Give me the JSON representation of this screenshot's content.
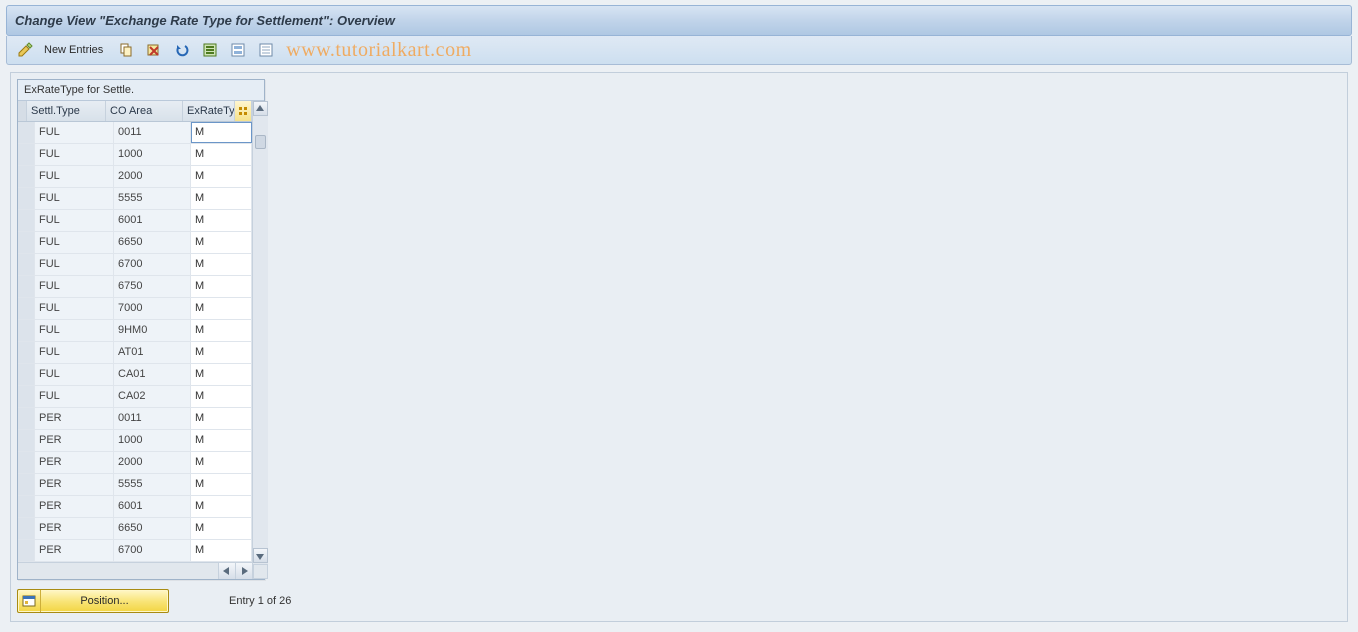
{
  "title": "Change View \"Exchange Rate Type for Settlement\": Overview",
  "toolbar": {
    "new_entries_label": "New Entries"
  },
  "watermark": "www.tutorialkart.com",
  "grid": {
    "title": "ExRateType for Settle.",
    "headers": {
      "settl_type": "Settl.Type",
      "co_area": "CO Area",
      "ex_rate_type": "ExRateType"
    },
    "rows": [
      {
        "settl": "FUL",
        "co": "0011",
        "ex": "M"
      },
      {
        "settl": "FUL",
        "co": "1000",
        "ex": "M"
      },
      {
        "settl": "FUL",
        "co": "2000",
        "ex": "M"
      },
      {
        "settl": "FUL",
        "co": "5555",
        "ex": "M"
      },
      {
        "settl": "FUL",
        "co": "6001",
        "ex": "M"
      },
      {
        "settl": "FUL",
        "co": "6650",
        "ex": "M"
      },
      {
        "settl": "FUL",
        "co": "6700",
        "ex": "M"
      },
      {
        "settl": "FUL",
        "co": "6750",
        "ex": "M"
      },
      {
        "settl": "FUL",
        "co": "7000",
        "ex": "M"
      },
      {
        "settl": "FUL",
        "co": "9HM0",
        "ex": "M"
      },
      {
        "settl": "FUL",
        "co": "AT01",
        "ex": "M"
      },
      {
        "settl": "FUL",
        "co": "CA01",
        "ex": "M"
      },
      {
        "settl": "FUL",
        "co": "CA02",
        "ex": "M"
      },
      {
        "settl": "PER",
        "co": "0011",
        "ex": "M"
      },
      {
        "settl": "PER",
        "co": "1000",
        "ex": "M"
      },
      {
        "settl": "PER",
        "co": "2000",
        "ex": "M"
      },
      {
        "settl": "PER",
        "co": "5555",
        "ex": "M"
      },
      {
        "settl": "PER",
        "co": "6001",
        "ex": "M"
      },
      {
        "settl": "PER",
        "co": "6650",
        "ex": "M"
      },
      {
        "settl": "PER",
        "co": "6700",
        "ex": "M"
      }
    ]
  },
  "footer": {
    "position_label": "Position...",
    "entry_status": "Entry 1 of 26"
  }
}
